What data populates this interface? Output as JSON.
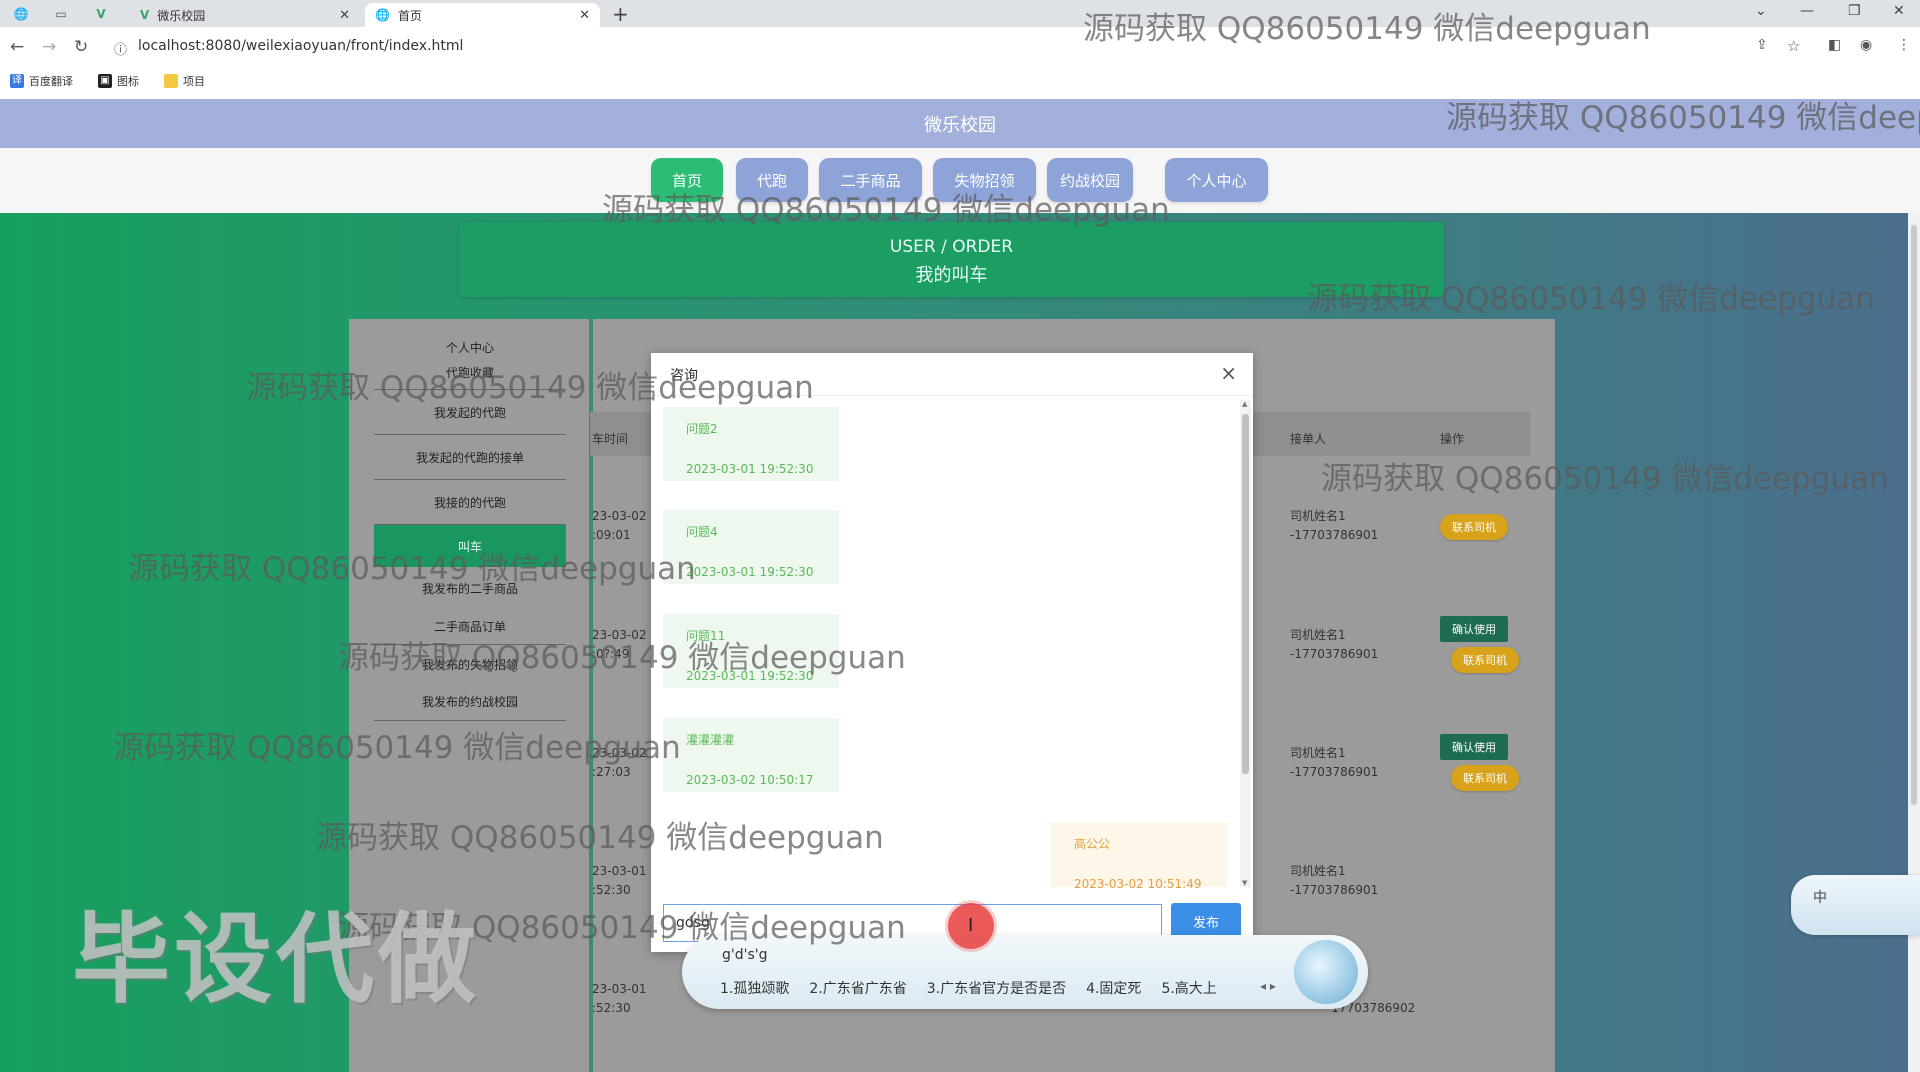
{
  "browser": {
    "tabs": [
      {
        "title": "微乐校园"
      },
      {
        "title": "首页"
      }
    ],
    "url": "localhost:8080/weilexiaoyuan/front/index.html",
    "bookmarks": [
      "百度翻译",
      "图标",
      "项目"
    ]
  },
  "site": {
    "title": "微乐校园",
    "nav": [
      "首页",
      "代跑",
      "二手商品",
      "失物招领",
      "约战校园",
      "个人中心"
    ],
    "banner_en": "USER / ORDER",
    "banner_cn": "我的叫车"
  },
  "sidebar": {
    "items": [
      "个人中心",
      "代跑收藏",
      "我发起的代跑",
      "我发起的代跑的接单",
      "我接的的代跑",
      "叫车",
      "我发布的二手商品",
      "二手商品订单",
      "我发布的失物招领",
      "我发布的约战校园"
    ]
  },
  "table": {
    "headers": {
      "time": "车时间",
      "receiver": "接单人",
      "action": "操作"
    },
    "rows": [
      {
        "time1": "23-03-02",
        "time2": ":09:01",
        "driver": "司机姓名1",
        "phone": "-17703786901",
        "buttons": [
          "联系司机"
        ]
      },
      {
        "time1": "23-03-02",
        "time2": ":0?:49",
        "driver": "司机姓名1",
        "phone": "-17703786901",
        "buttons": [
          "确认使用",
          "联系司机"
        ]
      },
      {
        "time1": "23-03-02",
        "time2": ":27:03",
        "driver": "司机姓名1",
        "phone": "-17703786901",
        "buttons": [
          "确认使用",
          "联系司机"
        ]
      },
      {
        "time1": "23-03-01",
        "time2": ":52:30",
        "driver": "司机姓名1",
        "phone": "-17703786901",
        "buttons": []
      },
      {
        "time1": "23-03-01",
        "time2": ":52:30",
        "driver": "",
        "phone": "-17703786902",
        "buttons": []
      }
    ]
  },
  "dialog": {
    "title": "咨询",
    "messages": [
      {
        "side": "left",
        "text": "问题2",
        "time": "2023-03-01 19:52:30"
      },
      {
        "side": "left",
        "text": "问题4",
        "time": "2023-03-01 19:52:30"
      },
      {
        "side": "left",
        "text": "问题11",
        "time": "2023-03-01 19:52:30"
      },
      {
        "side": "left",
        "text": "灌灌灌灌",
        "time": "2023-03-02 10:50:17"
      },
      {
        "side": "right",
        "text": "高公公",
        "time": "2023-03-02 10:51:49"
      }
    ],
    "input_value": "gdsg",
    "send_label": "发布"
  },
  "ime": {
    "pinyin": "g'd's'g",
    "candidates": [
      "1.孤独颂歌",
      "2.广东省广东省",
      "3.广东省官方是否是否",
      "4.固定死",
      "5.高大上"
    ],
    "side_label": "中"
  },
  "watermark": {
    "text": "源码获取 QQ86050149 微信deepguan",
    "text_cut": "源码获取 QQ86050149 微信deepg",
    "big": "毕设代做"
  }
}
